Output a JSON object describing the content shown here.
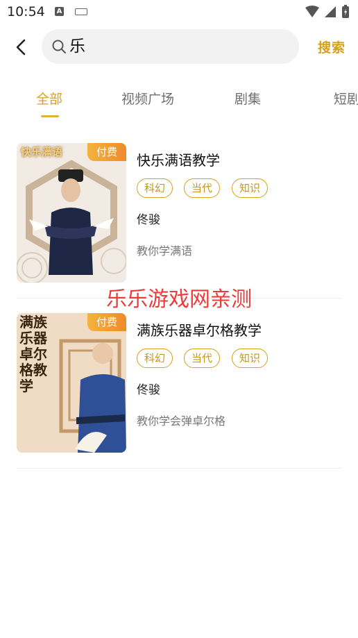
{
  "status_bar": {
    "time": "10:54",
    "a_glyph": "A"
  },
  "header": {
    "back_icon": "chevron-left-icon",
    "search_value": "乐",
    "search_button": "搜索"
  },
  "tabs": [
    {
      "label": "全部",
      "active": true
    },
    {
      "label": "视频广场",
      "active": false
    },
    {
      "label": "剧集",
      "active": false
    },
    {
      "label": "短剧",
      "active": false
    }
  ],
  "results": [
    {
      "cover_text": "快乐满语",
      "badge": "付费",
      "title": "快乐满语教学",
      "tags": [
        "科幻",
        "当代",
        "知识"
      ],
      "author": "佟骏",
      "description": "教你学满语"
    },
    {
      "cover_text": "满族乐器卓尔格教学",
      "badge": "付费",
      "title": "满族乐器卓尔格教学",
      "tags": [
        "科幻",
        "当代",
        "知识"
      ],
      "author": "佟骏",
      "description": "教你学会弹卓尔格"
    }
  ],
  "watermark": "乐乐游戏网亲测",
  "colors": {
    "accent": "#d9a21b",
    "badge_start": "#f3b43d",
    "badge_end": "#ef8a2a",
    "watermark": "#ef3a3a"
  }
}
